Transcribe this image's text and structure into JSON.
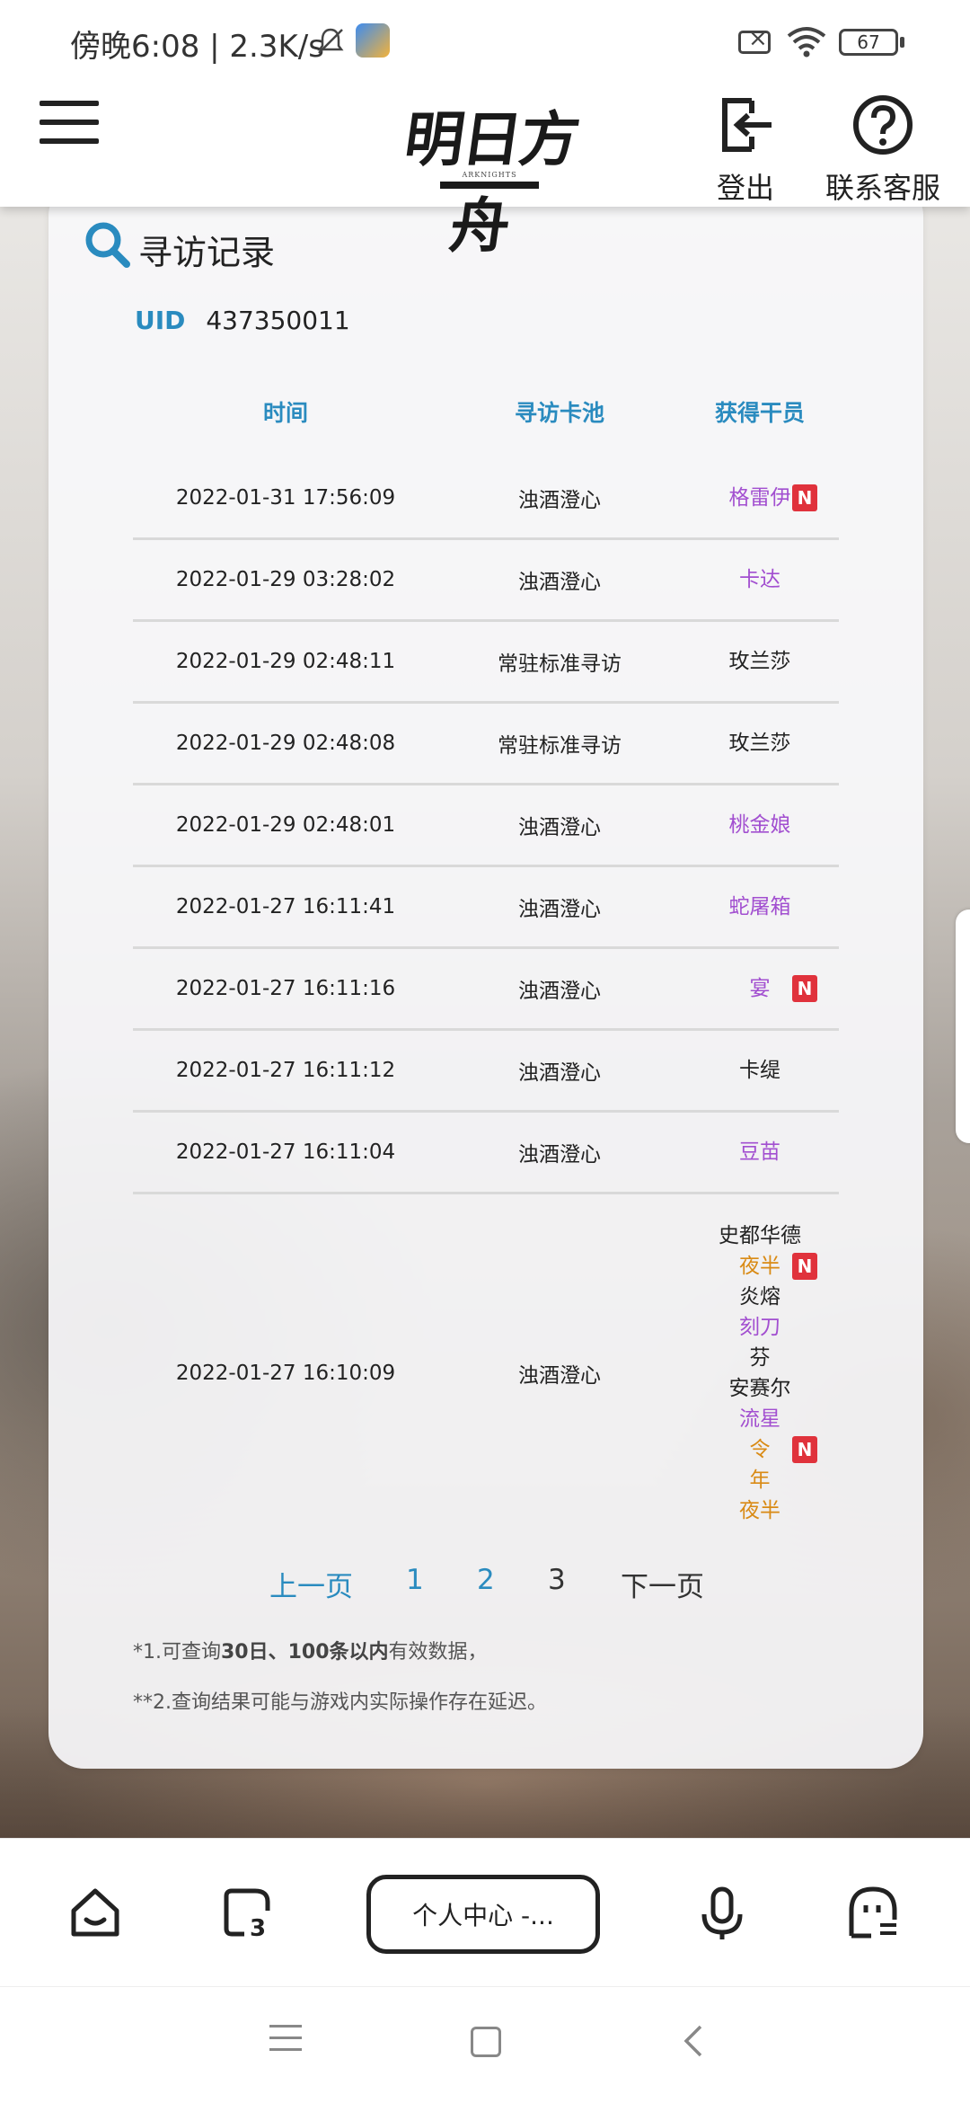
{
  "status": {
    "time": "傍晚6:08 | 2.3K/s",
    "battery": "67"
  },
  "header": {
    "logo_text": "明日方舟",
    "logo_sub": "ARKNIGHTS",
    "logout_label": "登出",
    "help_label": "联系客服"
  },
  "card": {
    "title": "寻访记录",
    "uid_label": "UID",
    "uid_value": "437350011",
    "columns": [
      "时间",
      "寻访卡池",
      "获得干员"
    ],
    "rows": [
      {
        "time": "2022-01-31 17:56:09",
        "pool": "浊酒澄心",
        "operators": [
          {
            "name": "格雷伊",
            "color": "purple",
            "new": true
          }
        ]
      },
      {
        "time": "2022-01-29 03:28:02",
        "pool": "浊酒澄心",
        "operators": [
          {
            "name": "卡达",
            "color": "purple",
            "new": false
          }
        ]
      },
      {
        "time": "2022-01-29 02:48:11",
        "pool": "常驻标准寻访",
        "operators": [
          {
            "name": "玫兰莎",
            "color": "black",
            "new": false
          }
        ]
      },
      {
        "time": "2022-01-29 02:48:08",
        "pool": "常驻标准寻访",
        "operators": [
          {
            "name": "玫兰莎",
            "color": "black",
            "new": false
          }
        ]
      },
      {
        "time": "2022-01-29 02:48:01",
        "pool": "浊酒澄心",
        "operators": [
          {
            "name": "桃金娘",
            "color": "purple",
            "new": false
          }
        ]
      },
      {
        "time": "2022-01-27 16:11:41",
        "pool": "浊酒澄心",
        "operators": [
          {
            "name": "蛇屠箱",
            "color": "purple",
            "new": false
          }
        ]
      },
      {
        "time": "2022-01-27 16:11:16",
        "pool": "浊酒澄心",
        "operators": [
          {
            "name": "宴",
            "color": "purple",
            "new": true
          }
        ]
      },
      {
        "time": "2022-01-27 16:11:12",
        "pool": "浊酒澄心",
        "operators": [
          {
            "name": "卡缇",
            "color": "black",
            "new": false
          }
        ]
      },
      {
        "time": "2022-01-27 16:11:04",
        "pool": "浊酒澄心",
        "operators": [
          {
            "name": "豆苗",
            "color": "purple",
            "new": false
          }
        ]
      },
      {
        "time": "2022-01-27 16:10:09",
        "pool": "浊酒澄心",
        "operators": [
          {
            "name": "史都华德",
            "color": "black",
            "new": false
          },
          {
            "name": "夜半",
            "color": "orange",
            "new": true
          },
          {
            "name": "炎熔",
            "color": "black",
            "new": false
          },
          {
            "name": "刻刀",
            "color": "purple",
            "new": false
          },
          {
            "name": "芬",
            "color": "black",
            "new": false
          },
          {
            "name": "安赛尔",
            "color": "black",
            "new": false
          },
          {
            "name": "流星",
            "color": "purple",
            "new": false
          },
          {
            "name": "令",
            "color": "orange",
            "new": true
          },
          {
            "name": "年",
            "color": "orange",
            "new": false
          },
          {
            "name": "夜半",
            "color": "orange",
            "new": false
          }
        ]
      }
    ],
    "new_badge": "N"
  },
  "pagination": {
    "prev": "上一页",
    "pages": [
      "1",
      "2",
      "3"
    ],
    "current": "3",
    "next": "下一页"
  },
  "notes": {
    "note1_a": "*1.可查询",
    "note1_b": "30日、100条以内",
    "note1_c": "有效数据，",
    "note2": "**2.查询结果可能与游戏内实际操作存在延迟。"
  },
  "toolbar": {
    "address": "个人中心 -..."
  },
  "colors": {
    "accent": "#2a8bbf",
    "purple": "#a24fd0",
    "orange": "#d98a14",
    "badge": "#e0323c"
  }
}
